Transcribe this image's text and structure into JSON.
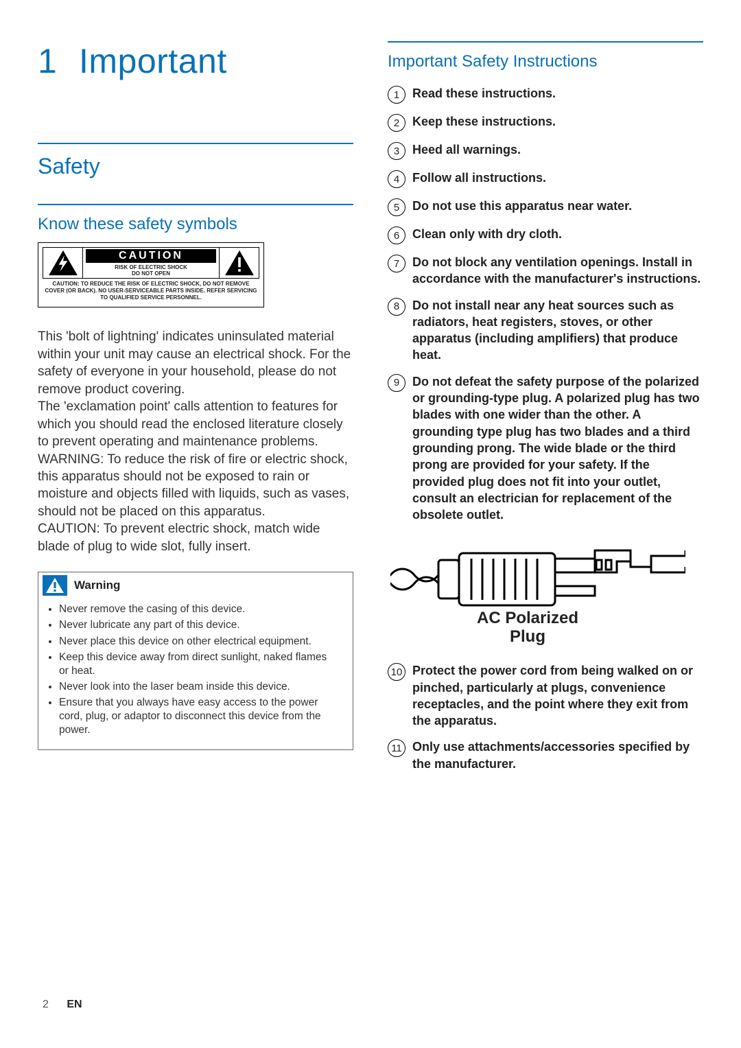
{
  "chapter": {
    "number": "1",
    "title": "Important"
  },
  "section_safety": "Safety",
  "sub_know": "Know these safety symbols",
  "caution": {
    "title": "CAUTION",
    "sub1": "RISK OF ELECTRIC SHOCK",
    "sub2": "DO NOT OPEN",
    "bottom": "CAUTION: TO REDUCE THE RISK OF ELECTRIC SHOCK, DO NOT REMOVE COVER (OR BACK). NO USER-SERVICEABLE PARTS INSIDE. REFER SERVICING TO QUALIFIED SERVICE PERSONNEL."
  },
  "para1": "This 'bolt of lightning' indicates uninsulated material within your unit may cause an electrical shock. For the safety of everyone in your household, please do not remove product covering.",
  "para2": "The 'exclamation point' calls attention to features for which you should read the enclosed literature closely to prevent operating and maintenance problems.",
  "para3": "WARNING: To reduce the risk of fire or electric shock, this apparatus should not be exposed to rain or moisture and objects filled with liquids, such as vases, should not be placed on this apparatus.",
  "para4": "CAUTION: To prevent electric shock, match wide blade of plug to wide slot, fully insert.",
  "warning": {
    "label": "Warning",
    "items": [
      "Never remove the casing of this device.",
      "Never lubricate any part of this device.",
      "Never place this device on other electrical equipment.",
      "Keep this device away from direct sunlight, naked flames or heat.",
      "Never look into the laser beam inside this device.",
      "Ensure that you always have easy access to the power cord, plug, or adaptor to disconnect this device from the power."
    ]
  },
  "sub_instr": "Important Safety Instructions",
  "instructions": [
    "Read these instructions.",
    "Keep these instructions.",
    "Heed all warnings.",
    "Follow all instructions.",
    "Do not use this apparatus near water.",
    "Clean only with dry cloth.",
    "Do not block any ventilation openings. Install in accordance with the manufacturer's instructions.",
    "Do not install near any heat sources such as radiators, heat registers, stoves, or other apparatus (including amplifiers) that produce heat.",
    "Do not defeat the safety purpose of the polarized or grounding-type plug. A polarized plug has two blades with one wider than the other. A grounding type plug has two blades and a third grounding prong. The wide blade or the third prong are provided for your safety. If the provided plug does not fit into your outlet, consult an electrician for replacement of the obsolete outlet.",
    "Protect the power cord from being walked on or pinched, particularly at plugs, convenience receptacles, and the point where they exit from the apparatus.",
    "Only use attachments/accessories specified by the manufacturer."
  ],
  "plug_caption_1": "AC Polarized",
  "plug_caption_2": "Plug",
  "footer": {
    "page": "2",
    "lang": "EN"
  }
}
